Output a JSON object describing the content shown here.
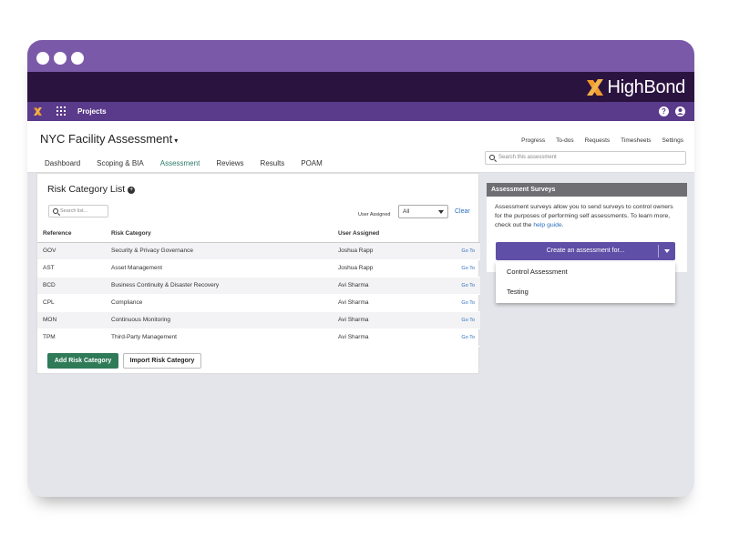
{
  "brand": {
    "name": "HighBond",
    "accent": "#f29a2e"
  },
  "nav": {
    "projects_label": "Projects",
    "help_label": "?"
  },
  "header": {
    "title": "NYC Facility Assessment",
    "caret": "▾",
    "links": [
      "Progress",
      "To-dos",
      "Requests",
      "Timesheets",
      "Settings"
    ],
    "search_placeholder": "Search this assessment",
    "tabs": [
      "Dashboard",
      "Scoping & BIA",
      "Assessment",
      "Reviews",
      "Results",
      "POAM"
    ],
    "active_tab": "Assessment"
  },
  "risk_list": {
    "title": "Risk Category List",
    "plus": "+",
    "search_placeholder": "Search list...",
    "user_assigned_label": "User Assigned",
    "user_assigned_value": "All",
    "clear_label": "Clear",
    "columns": [
      "Reference",
      "Risk Category",
      "User Assigned",
      ""
    ],
    "rows": [
      {
        "ref": "GOV",
        "category": "Security & Privacy Governance",
        "user": "Joshua Rapp",
        "action": "Go To"
      },
      {
        "ref": "AST",
        "category": "Asset Management",
        "user": "Joshua Rapp",
        "action": "Go To"
      },
      {
        "ref": "BCD",
        "category": "Business Continuity & Disaster Recovery",
        "user": "Avi Sharma",
        "action": "Go To"
      },
      {
        "ref": "CPL",
        "category": "Compliance",
        "user": "Avi Sharma",
        "action": "Go To"
      },
      {
        "ref": "MON",
        "category": "Continuous Monitoring",
        "user": "Avi Sharma",
        "action": "Go To"
      },
      {
        "ref": "TPM",
        "category": "Third-Party Management",
        "user": "Avi Sharma",
        "action": "Go To"
      }
    ],
    "add_button": "Add Risk Category",
    "import_button": "Import Risk Category"
  },
  "surveys": {
    "title": "Assessment Surveys",
    "text": "Assessment surveys allow you to send surveys to control owners for the purposes of performing self assessments. To learn more, check out the",
    "link": "help guide",
    "period": ".",
    "create_button": "Create an assessment for...",
    "options": [
      "Control Assessment",
      "Testing"
    ]
  }
}
